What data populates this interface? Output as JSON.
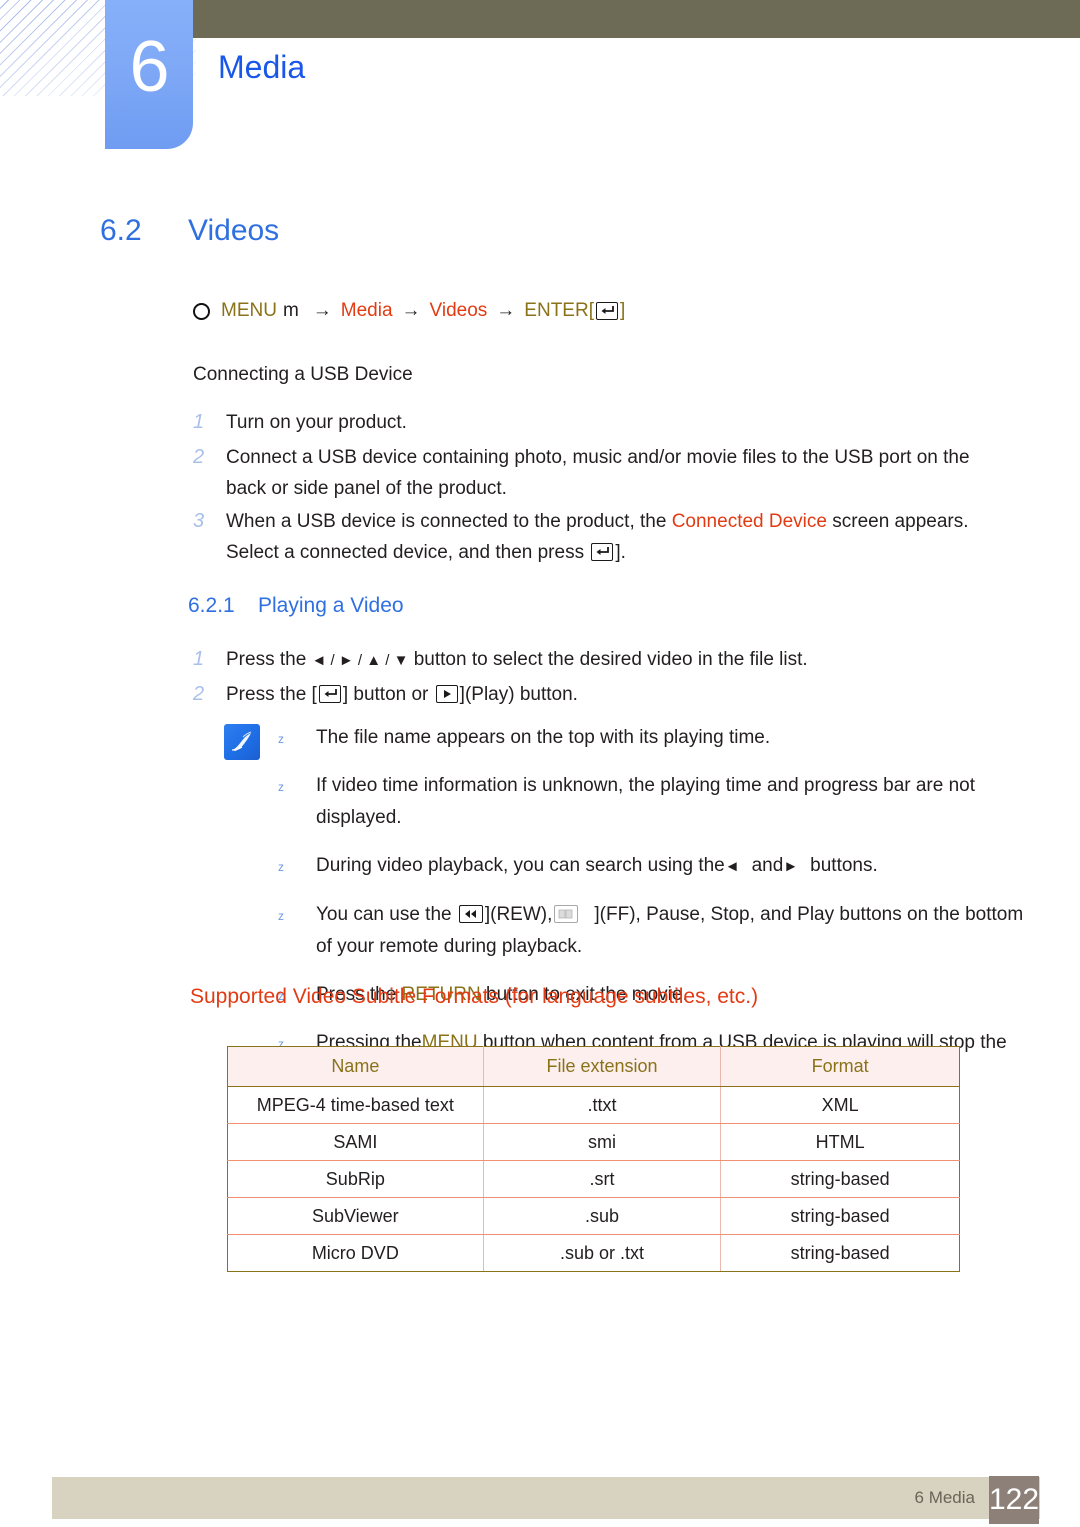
{
  "header": {
    "chapter_number": "6",
    "chapter_title": "Media"
  },
  "section": {
    "number": "6.2",
    "title": "Videos"
  },
  "menu_path": {
    "bullet": "circle-outline-icon",
    "menu_label": "MENU",
    "menu_key": "m",
    "arrow": "→",
    "item1": "Media",
    "item2": "Videos",
    "enter_label": "ENTER",
    "bracket_open": "[",
    "bracket_close": "]",
    "enter_icon": "enter-key-icon"
  },
  "usb": {
    "heading": "Connecting a USB Device",
    "steps": [
      {
        "n": "1",
        "text": "Turn on your product."
      },
      {
        "n": "2",
        "text": "Connect a USB device containing photo, music and/or movie files to the USB port on the back or side panel of the product."
      },
      {
        "n": "3",
        "pre": "When a USB device is connected to the product, the ",
        "highlight": "Connected Device",
        "post": " screen appears. Select a connected device, and then press ",
        "tail": "]."
      }
    ]
  },
  "playing": {
    "number": "6.2.1",
    "title": "Playing a Video",
    "steps": [
      {
        "n": "1",
        "pre": "Press the ",
        "keys": "◄ / ► / ▲ / ▼",
        "post": " button to select the desired video in the file list."
      },
      {
        "n": "2",
        "pre": "Press the [",
        "mid": "] button or ",
        "post": "](Play) button."
      }
    ]
  },
  "notes": {
    "icon": "note-pen-icon",
    "bullet": "z",
    "items": [
      {
        "text": "The file name appears on the top with its playing time."
      },
      {
        "text": "If video time information is unknown, the playing time and progress bar are not displayed."
      },
      {
        "pre": "During video playback, you can search using the",
        "k1": "◄",
        "mid": "and",
        "k2": "►",
        "post": "buttons."
      },
      {
        "pre": "You can use the ",
        "rew_label": "](REW),",
        "ff_label": "](FF), Pause, Stop, and Play buttons on the bottom of your remote during playback."
      },
      {
        "pre": "Press the ",
        "highlight": "RETURN",
        "post": " button to exit the movie."
      },
      {
        "pre": "Pressing the",
        "highlight": "MENU",
        "post": " button when content from a USB device is playing will stop the playback and return you to the previous input mode."
      }
    ]
  },
  "table": {
    "caption": "Supported Video Subitle Formats (for language subtiles, etc.)",
    "columns": [
      "Name",
      "File extension",
      "Format"
    ],
    "rows": [
      [
        "MPEG-4 time-based text",
        ".ttxt",
        "XML"
      ],
      [
        "SAMI",
        "smi",
        "HTML"
      ],
      [
        "SubRip",
        ".srt",
        "string-based"
      ],
      [
        "SubViewer",
        ".sub",
        "string-based"
      ],
      [
        "Micro DVD",
        ".sub or .txt",
        "string-based"
      ]
    ]
  },
  "footer": {
    "label": "6 Media",
    "page": "122"
  },
  "colors": {
    "chapter_blue": "#7fa9f6",
    "heading_blue": "#2f6fe0",
    "olive_bar": "#6d6a55",
    "olive_text": "#8a7219",
    "red_text": "#e23b13",
    "footer_bar": "#d8d2c0",
    "footer_page_box": "#8d8078",
    "table_header_bg": "#fcefee"
  }
}
